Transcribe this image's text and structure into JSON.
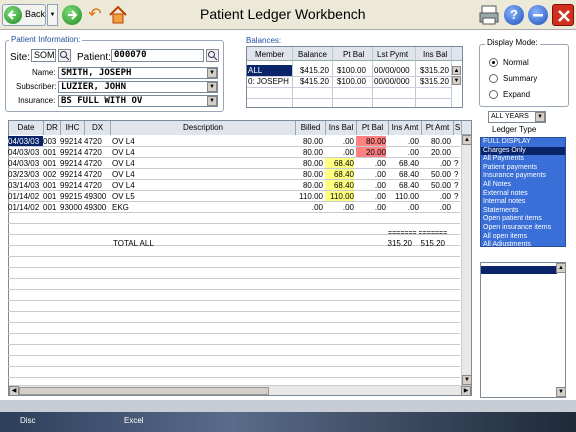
{
  "toolbar": {
    "back_label": "Back",
    "title": "Patient Ledger Workbench"
  },
  "patient_info": {
    "group_label": "Patient Information:",
    "site_label": "Site:",
    "site_value": "SOM",
    "patient_label": "Patient:",
    "patient_value": "000070",
    "name_label": "Name:",
    "name_value": "SMITH, JOSEPH",
    "subscriber_label": "Subscriber:",
    "subscriber_value": "LUZIER, JOHN",
    "insurance_label": "Insurance:",
    "insurance_value": "BS FULL WITH OV"
  },
  "balances": {
    "group_label": "Balances:",
    "headers": [
      "Member",
      "Balance",
      "Pt Bal",
      "Lst Pymt",
      "Ins Bal"
    ],
    "rows": [
      [
        "ALL",
        "$415.20",
        "$100.00",
        "00/00/000",
        "$315.20"
      ],
      [
        "0: JOSEPH",
        "$415.20",
        "$100.00",
        "00/00/000",
        "$315.20"
      ]
    ]
  },
  "display_mode": {
    "group_label": "Display Mode:",
    "options": [
      "Normal",
      "Summary",
      "Expand"
    ],
    "selected": "Normal"
  },
  "years_value": "ALL YEARS",
  "ledger_type_label": "Ledger Type",
  "ledger_types": [
    "FULL DISPLAY",
    "Charges Only",
    "All Payments",
    "Patient payments",
    "Insurance payments",
    "All Notes",
    "External notes",
    "Internal notes",
    "Statements",
    "Open patient items",
    "Open insurance items",
    "All open items",
    "All Adjustments"
  ],
  "ledger": {
    "headers": [
      "Date",
      "DR",
      "IHC",
      "DX",
      "Description",
      "Billed",
      "Ins Bal",
      "Pt Bal",
      "Ins Amt",
      "Pt Amt",
      "S"
    ],
    "rows": [
      {
        "date": "04/03/03",
        "dr": "003",
        "ihc": "99214",
        "dx": "4720",
        "desc": "OV L4",
        "billed": "80.00",
        "ins_bal": ".00",
        "pt_bal": "80.00",
        "ins_amt": ".00",
        "pt_amt": "80.00",
        "s": ""
      },
      {
        "date": "04/03/03",
        "dr": "001",
        "ihc": "99214",
        "dx": "4720",
        "desc": "OV L4",
        "billed": "80.00",
        "ins_bal": ".00",
        "pt_bal": "20.00",
        "ins_amt": ".00",
        "pt_amt": "20.00",
        "s": ""
      },
      {
        "date": "04/03/03",
        "dr": "001",
        "ihc": "99214",
        "dx": "4720",
        "desc": "OV L4",
        "billed": "80.00",
        "ins_bal": "68.40",
        "pt_bal": ".00",
        "ins_amt": "68.40",
        "pt_amt": ".00",
        "s": "?"
      },
      {
        "date": "03/23/03",
        "dr": "002",
        "ihc": "99214",
        "dx": "4720",
        "desc": "OV L4",
        "billed": "80.00",
        "ins_bal": "68.40",
        "pt_bal": ".00",
        "ins_amt": "68.40",
        "pt_amt": "50.00",
        "s": "?"
      },
      {
        "date": "03/14/03",
        "dr": "001",
        "ihc": "99214",
        "dx": "4720",
        "desc": "OV L4",
        "billed": "80.00",
        "ins_bal": "68.40",
        "pt_bal": ".00",
        "ins_amt": "68.40",
        "pt_amt": "50.00",
        "s": "?"
      },
      {
        "date": "01/14/02",
        "dr": "001",
        "ihc": "99215",
        "dx": "49300",
        "desc": "OV L5",
        "billed": "110.00",
        "ins_bal": "110.00",
        "pt_bal": ".00",
        "ins_amt": "110.00",
        "pt_amt": ".00",
        "s": "?"
      },
      {
        "date": "01/14/02",
        "dr": "001",
        "ihc": "93000",
        "dx": "49300",
        "desc": "EKG",
        "billed": ".00",
        "ins_bal": ".00",
        "pt_bal": ".00",
        "ins_amt": ".00",
        "pt_amt": ".00",
        "s": ""
      }
    ],
    "separator": "======= =======",
    "total_label": "TOTAL ALL",
    "total_ins": "315.20",
    "total_pt": "515.20"
  },
  "taskbar": {
    "disc_label": "Disc",
    "excel_label": "Excel"
  }
}
